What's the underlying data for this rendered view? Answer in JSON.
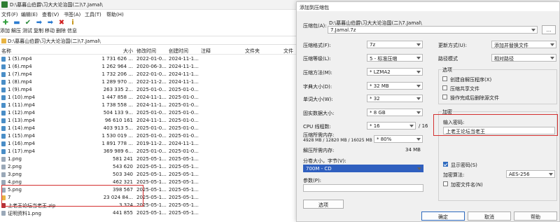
{
  "filemanager": {
    "title": "D:\\墓暮山伯爵\\习大大论治国(二)\\7.Jamal\\",
    "menu": [
      "文件(F)",
      "编辑(E)",
      "查看(V)",
      "书签(A)",
      "工具(T)",
      "帮助(H)"
    ],
    "toolbar": [
      {
        "icon": "add-icon",
        "label": "添加",
        "color": "#2e9e3a",
        "glyph": "✚"
      },
      {
        "icon": "extract-icon",
        "label": "解压",
        "color": "#2b7bd0",
        "glyph": "▬"
      },
      {
        "icon": "test-icon",
        "label": "测试",
        "color": "#2a8a3a",
        "glyph": "✔"
      },
      {
        "icon": "copy-icon",
        "label": "复制",
        "color": "#2b7bd0",
        "glyph": "➡"
      },
      {
        "icon": "move-icon",
        "label": "移动",
        "color": "#2b7bd0",
        "glyph": "➡"
      },
      {
        "icon": "delete-icon",
        "label": "删除",
        "color": "#d02020",
        "glyph": "✖"
      },
      {
        "icon": "info-icon",
        "label": "信息",
        "color": "#c08a00",
        "glyph": "i"
      }
    ],
    "path": "D:\\墓暮山伯爵\\习大大论治国(二)\\7.Jamal\\",
    "headers": {
      "name": "名称",
      "size": "大小",
      "modified": "修改时间",
      "created": "创建时间",
      "comment": "注释",
      "folders": "文件夹",
      "files": "文件"
    },
    "files": [
      {
        "name": "1 (5).mp4",
        "size": "1 731 626 ...",
        "modified": "2022-01-0...",
        "created": "2024-11-1...",
        "type": "video"
      },
      {
        "name": "1 (6).mp4",
        "size": "1 262 964 ...",
        "modified": "2020-06-3...",
        "created": "2024-11-1...",
        "type": "video"
      },
      {
        "name": "1 (7).mp4",
        "size": "1 732 206 ...",
        "modified": "2022-01-0...",
        "created": "2024-11-1...",
        "type": "video"
      },
      {
        "name": "1 (8).mp4",
        "size": "1 289 970 ...",
        "modified": "2022-11-2...",
        "created": "2024-11-1...",
        "type": "video"
      },
      {
        "name": "1 (9).mp4",
        "size": "263 335 2...",
        "modified": "2025-01-0...",
        "created": "2025-01-0...",
        "type": "video"
      },
      {
        "name": "1 (10).mp4",
        "size": "1 447 858 ...",
        "modified": "2024-11-1...",
        "created": "2025-01-0...",
        "type": "video"
      },
      {
        "name": "1 (11).mp4",
        "size": "1 738 558 ...",
        "modified": "2024-11-1...",
        "created": "2025-01-0...",
        "type": "video"
      },
      {
        "name": "1 (12).mp4",
        "size": "504 133 9...",
        "modified": "2025-01-0...",
        "created": "2025-01-0...",
        "type": "video"
      },
      {
        "name": "1 (13).mp4",
        "size": "96 610 161",
        "modified": "2024-11-1...",
        "created": "2025-01-0...",
        "type": "video"
      },
      {
        "name": "1 (14).mp4",
        "size": "403 913 5...",
        "modified": "2025-01-0...",
        "created": "2025-01-0...",
        "type": "video"
      },
      {
        "name": "1 (15).mp4",
        "size": "1 530 019 ...",
        "modified": "2025-01-0...",
        "created": "2025-01-0...",
        "type": "video"
      },
      {
        "name": "1 (16).mp4",
        "size": "1 891 778 ...",
        "modified": "2019-11-2...",
        "created": "2024-11-1...",
        "type": "video"
      },
      {
        "name": "1 (17).mp4",
        "size": "369 989 6...",
        "modified": "2025-01-0...",
        "created": "2025-01-0...",
        "type": "video"
      },
      {
        "name": "1.png",
        "size": "581 241",
        "modified": "2025-05-1...",
        "created": "2025-05-1...",
        "type": "png"
      },
      {
        "name": "2.png",
        "size": "543 620",
        "modified": "2025-05-1...",
        "created": "2025-05-1...",
        "type": "png"
      },
      {
        "name": "3.png",
        "size": "503 340",
        "modified": "2025-05-1...",
        "created": "2025-05-1...",
        "type": "png"
      },
      {
        "name": "4.png",
        "size": "462 321",
        "modified": "2025-05-1...",
        "created": "2025-05-1...",
        "type": "png"
      },
      {
        "name": "5.png",
        "size": "398 567",
        "modified": "2025-05-1...",
        "created": "2025-05-1...",
        "type": "png"
      },
      {
        "name": "7",
        "size": "23 024 84...",
        "modified": "2025-05-1...",
        "created": "2025-05-1...",
        "type": "folder"
      },
      {
        "name": "上老王论坛当老王.zip",
        "size": "3 324",
        "modified": "2025-05-1...",
        "created": "2025-05-1...",
        "type": "zip"
      },
      {
        "name": "证明资料1.png",
        "size": "441 855",
        "modified": "2025-05-1...",
        "created": "2025-05-1...",
        "type": "png"
      }
    ]
  },
  "dialog": {
    "title": "添加到压缩包",
    "archive_label": "压缩包(A):",
    "archive_dir": "D:\\墓暮山伯爵\\习大大论治国(二)\\7.Jamal\\",
    "archive_name": "7.Jamal.7z",
    "browse_label": "...",
    "format_label": "压缩格式(F):",
    "format_value": "7z",
    "level_label": "压缩等级(L):",
    "level_value": "5 - 标准压缩",
    "method_label": "压缩方法(M):",
    "method_value": "* LZMA2",
    "dict_label": "字典大小(D):",
    "dict_value": "* 32 MB",
    "word_label": "单词大小(W):",
    "word_value": "* 32",
    "solid_label": "固实数据大小:",
    "solid_value": "* 8 GB",
    "threads_label": "CPU 线程数:",
    "threads_value": "* 16",
    "threads_total": "/ 16",
    "mem_usage_label": "压缩所需内存:",
    "mem_usage_detail": "4928 MB / 12820 MB / 16025 MB",
    "mem_percent": "* 80%",
    "decomp_mem_label": "解压所需内存:",
    "decomp_mem_value": "34 MB",
    "split_label": "分卷大小，字节(V):",
    "split_value": "700M - CD",
    "params_label": "参数(P):",
    "params_value": "",
    "options_button": "选项",
    "update_label": "更新方式(U):",
    "update_value": "添加并替换文件",
    "pathmode_label": "路径模式",
    "pathmode_value": "相对路径",
    "options_group": "选项",
    "opt_sfx": "创建自解压程序(X)",
    "opt_shared": "压缩共享文件",
    "opt_delete": "操作完成后删除源文件",
    "encrypt_group": "加密",
    "password_label": "输入密码:",
    "password_value": "上老王论坛当老王",
    "show_password": "显示密码(S)",
    "encrypt_method_label": "加密算法:",
    "encrypt_method_value": "AES-256",
    "encrypt_names": "加密文件名(N)",
    "ok": "确定",
    "cancel": "取消",
    "help": "帮助"
  }
}
